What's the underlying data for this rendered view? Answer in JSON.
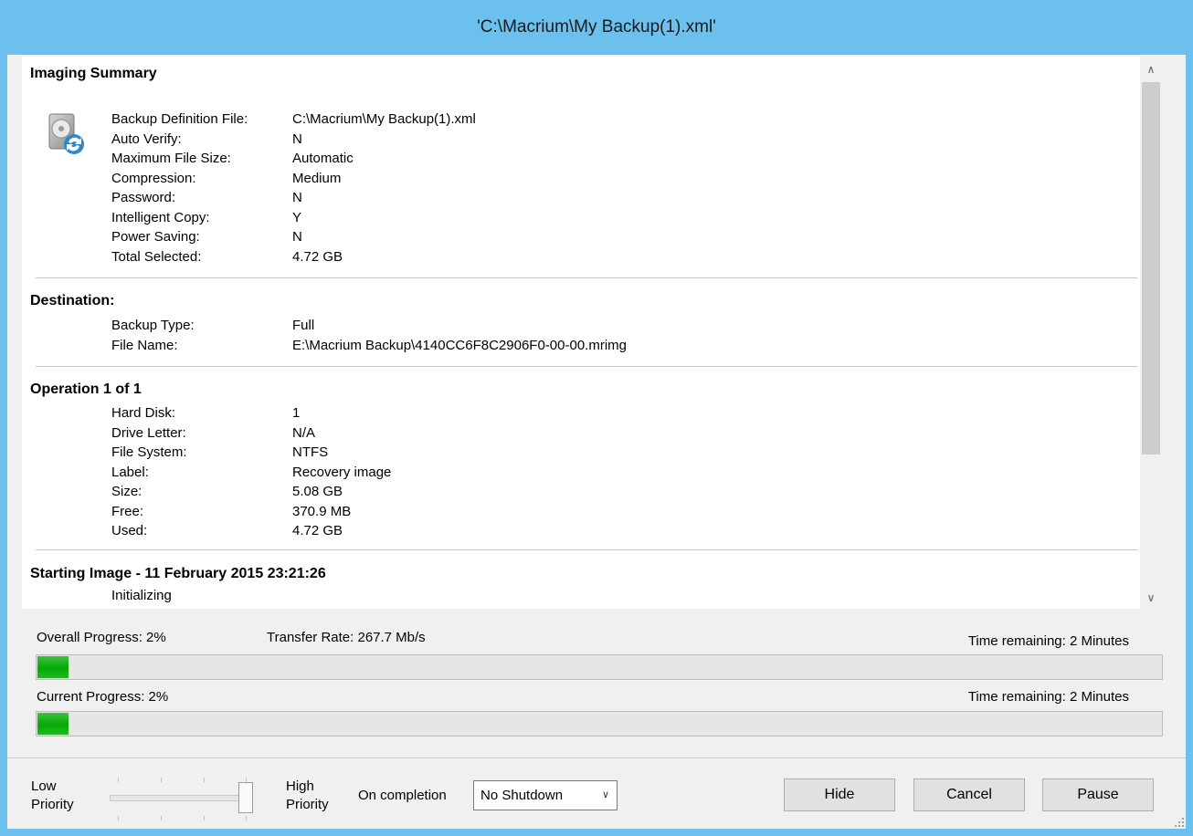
{
  "window": {
    "title": "'C:\\Macrium\\My Backup(1).xml'"
  },
  "summary": {
    "imaging": {
      "title": "Imaging Summary",
      "rows": [
        {
          "label": "Backup Definition File:",
          "value": "C:\\Macrium\\My Backup(1).xml"
        },
        {
          "label": "Auto Verify:",
          "value": "N"
        },
        {
          "label": "Maximum File Size:",
          "value": "Automatic"
        },
        {
          "label": "Compression:",
          "value": "Medium"
        },
        {
          "label": "Password:",
          "value": "N"
        },
        {
          "label": "Intelligent Copy:",
          "value": "Y"
        },
        {
          "label": "Power Saving:",
          "value": "N"
        },
        {
          "label": "Total Selected:",
          "value": "4.72 GB"
        }
      ]
    },
    "destination": {
      "title": "Destination:",
      "rows": [
        {
          "label": "Backup Type:",
          "value": "Full"
        },
        {
          "label": "File Name:",
          "value": "E:\\Macrium Backup\\4140CC6F8C2906F0-00-00.mrimg"
        }
      ]
    },
    "operation": {
      "title": "Operation 1 of 1",
      "rows": [
        {
          "label": "Hard Disk:",
          "value": "1"
        },
        {
          "label": "Drive Letter:",
          "value": "N/A"
        },
        {
          "label": "File System:",
          "value": "NTFS"
        },
        {
          "label": "Label:",
          "value": "Recovery image"
        },
        {
          "label": "Size:",
          "value": "5.08 GB"
        },
        {
          "label": "Free:",
          "value": "370.9 MB"
        },
        {
          "label": "Used:",
          "value": "4.72 GB"
        }
      ]
    },
    "starting": {
      "title": "Starting Image - 11 February 2015 23:21:26",
      "status": "Initializing"
    }
  },
  "progress": {
    "overall_label": "Overall Progress:  2%",
    "overall_fraction": 0.02,
    "transfer_rate": "Transfer Rate: 267.7 Mb/s",
    "overall_time": "Time remaining: 2 Minutes",
    "current_label": "Current Progress:  2%",
    "current_fraction": 0.02,
    "current_time": "Time remaining: 2 Minutes"
  },
  "footer": {
    "low_priority": [
      "Low",
      "Priority"
    ],
    "high_priority": [
      "High",
      "Priority"
    ],
    "priority_level": 1.0,
    "on_completion_label": "On completion",
    "on_completion_value": "No Shutdown",
    "hide_label": "Hide",
    "cancel_label": "Cancel",
    "pause_label": "Pause"
  },
  "colors": {
    "titlebar": "#6cc0ee",
    "progress_fill": "#06a906"
  }
}
